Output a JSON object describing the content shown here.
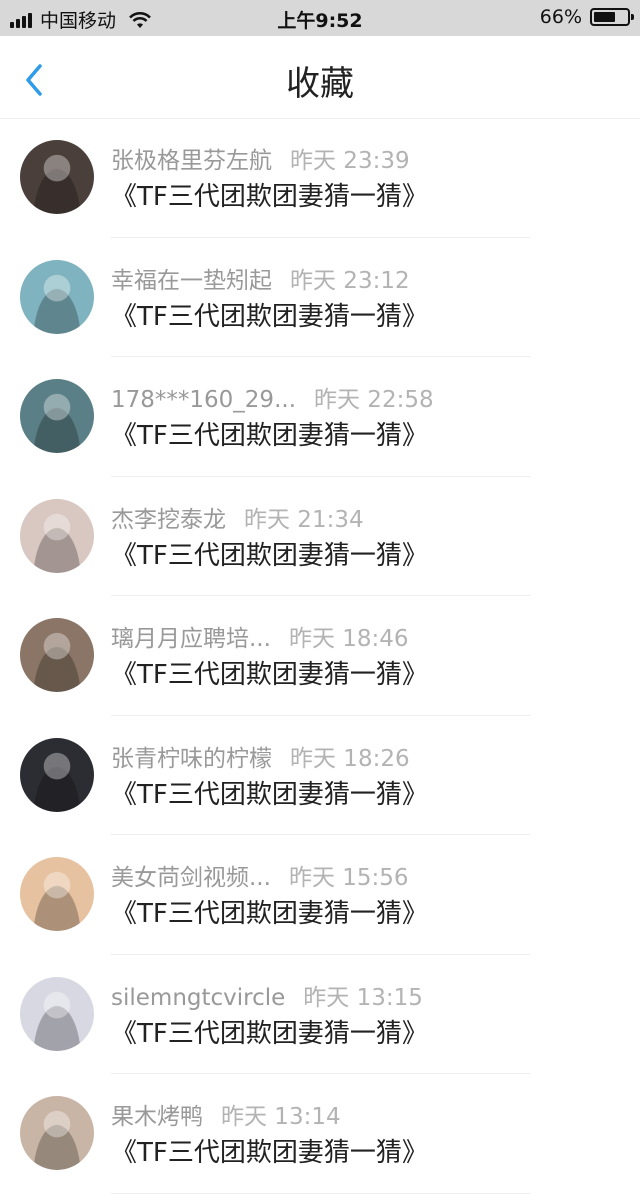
{
  "status_bar": {
    "carrier": "中国移动",
    "time": "上午9:52",
    "battery": "66%",
    "battery_level": 0.66
  },
  "header": {
    "title": "收藏"
  },
  "items": [
    {
      "name": "张极格里芬左航",
      "time": "昨天 23:39",
      "content": "《TF三代团欺团妻猜一猜》",
      "avatar_color": "#4a3f3a"
    },
    {
      "name": "幸福在一垫矧起",
      "time": "昨天 23:12",
      "content": "《TF三代团欺团妻猜一猜》",
      "avatar_color": "#7fb3bf"
    },
    {
      "name": "178***160_29...",
      "time": "昨天 22:58",
      "content": "《TF三代团欺团妻猜一猜》",
      "avatar_color": "#5a7f86"
    },
    {
      "name": "杰李挖泰龙",
      "time": "昨天 21:34",
      "content": "《TF三代团欺团妻猜一猜》",
      "avatar_color": "#d9c7c1"
    },
    {
      "name": "璃月月应聘培...",
      "time": "昨天 18:46",
      "content": "《TF三代团欺团妻猜一猜》",
      "avatar_color": "#8a7566"
    },
    {
      "name": "张青柠味的柠檬",
      "time": "昨天 18:26",
      "content": "《TF三代团欺团妻猜一猜》",
      "avatar_color": "#2c2c33"
    },
    {
      "name": "美女苘剑视频...",
      "time": "昨天 15:56",
      "content": "《TF三代团欺团妻猜一猜》",
      "avatar_color": "#e6c2a0"
    },
    {
      "name": "silemngtcvircle",
      "time": "昨天 13:15",
      "content": "《TF三代团欺团妻猜一猜》",
      "avatar_color": "#d8d8e3"
    },
    {
      "name": "果木烤鸭",
      "time": "昨天 13:14",
      "content": "《TF三代团欺团妻猜一猜》",
      "avatar_color": "#c9b5a6"
    }
  ]
}
